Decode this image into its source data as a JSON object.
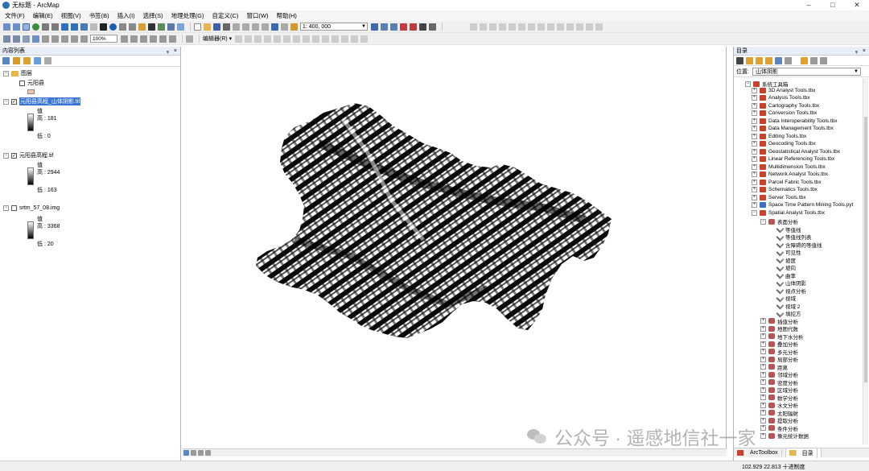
{
  "window": {
    "title": "无标题 - ArcMap",
    "controls": [
      "–",
      "□",
      "✕"
    ]
  },
  "menubar": [
    "文件(F)",
    "编辑(E)",
    "视图(V)",
    "书签(B)",
    "插入(I)",
    "选择(S)",
    "地理处理(G)",
    "自定义(C)",
    "窗口(W)",
    "帮助(H)"
  ],
  "toolbar": {
    "scale": "1: 400, 000",
    "zoom_percent": "100%",
    "editor_label": "编辑器(R) ▾"
  },
  "toc": {
    "title": "内容列表",
    "layers_group": "图层",
    "layers": [
      {
        "name": "元阳县",
        "checked": false
      },
      {
        "name": "元阳县高程_山体阴影.tif",
        "checked": true,
        "value_label": "值",
        "high": "高 : 181",
        "low": "低 : 0"
      },
      {
        "name": "元阳县高程.tif",
        "checked": true,
        "value_label": "值",
        "high": "高 : 2944",
        "low": "低 : 163"
      },
      {
        "name": "srtm_57_08.img",
        "checked": false,
        "value_label": "值",
        "high": "高 : 3368",
        "low": "低 : 20"
      }
    ]
  },
  "catalog": {
    "title": "目录",
    "location_label": "位置:",
    "location_value": "山体阴影",
    "root": "系统工具箱",
    "toolboxes": [
      "3D Analyst Tools.tbx",
      "Analysis Tools.tbx",
      "Cartography Tools.tbx",
      "Conversion Tools.tbx",
      "Data Interoperability Tools.tbx",
      "Data Management Tools.tbx",
      "Editing Tools.tbx",
      "Geocoding Tools.tbx",
      "Geostatistical Analyst Tools.tbx",
      "Linear Referencing Tools.tbx",
      "Multidimension Tools.tbx",
      "Network Analyst Tools.tbx",
      "Parcel Fabric Tools.tbx",
      "Schematics Tools.tbx",
      "Server Tools.tbx",
      "Space Time Pattern Mining Tools.pyt",
      "Spatial Analyst Tools.tbx"
    ],
    "surface_toolset": "表面分析",
    "surface_tools": [
      "等值线",
      "等值线列表",
      "含障碍的等值线",
      "可见性",
      "坡度",
      "坡向",
      "曲率",
      "山体阴影",
      "视点分析",
      "视域",
      "视域 2",
      "填挖方"
    ],
    "other_toolsets": [
      "插值分析",
      "地图代数",
      "地下水分析",
      "叠加分析",
      "多元分析",
      "局部分析",
      "距离",
      "邻域分析",
      "密度分析",
      "区域分析",
      "数学分析",
      "水文分析",
      "太阳辐射",
      "提取分析",
      "条件分析",
      "像元统计数据"
    ],
    "tabs": [
      "ArcToolbox",
      "目录"
    ]
  },
  "status": {
    "coords": "102.929  22.813 十进制度"
  },
  "watermark": {
    "text": "公众号 · 遥感地信社一家"
  }
}
